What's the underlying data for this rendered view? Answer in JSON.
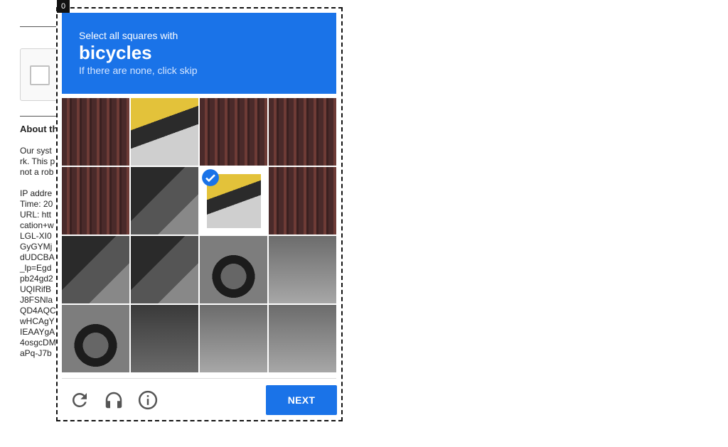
{
  "background": {
    "about_title": "About th",
    "paragraph": [
      "Our syst",
      "rk. This p",
      "not a rob"
    ],
    "details": [
      "IP addre",
      "Time: 20",
      "URL: htt",
      "cation+w",
      "LGL-XI0",
      "GyGYMj",
      "dUDCBA",
      "_lp=Egd",
      "pb24gd2",
      "UQIRifB",
      "J8FSNla",
      "QD4AQC",
      "wHCAgY",
      "IEAAYgA",
      "4osgcDM",
      "aPq-J7b"
    ]
  },
  "challenge": {
    "debug_index": "0",
    "instruction_prefix": "Select all squares with",
    "target": "bicycles",
    "hint": "If there are none, click skip",
    "tiles": [
      {
        "label": "tile 1",
        "selected": false
      },
      {
        "label": "tile 2",
        "selected": false
      },
      {
        "label": "tile 3",
        "selected": false
      },
      {
        "label": "tile 4",
        "selected": false
      },
      {
        "label": "tile 5",
        "selected": false
      },
      {
        "label": "tile 6",
        "selected": false
      },
      {
        "label": "tile 7",
        "selected": true
      },
      {
        "label": "tile 8",
        "selected": false
      },
      {
        "label": "tile 9",
        "selected": false
      },
      {
        "label": "tile 10",
        "selected": false
      },
      {
        "label": "tile 11",
        "selected": false
      },
      {
        "label": "tile 12",
        "selected": false
      },
      {
        "label": "tile 13",
        "selected": false
      },
      {
        "label": "tile 14",
        "selected": false
      },
      {
        "label": "tile 15",
        "selected": false
      },
      {
        "label": "tile 16",
        "selected": false
      }
    ],
    "next_label": "NEXT",
    "icons": {
      "reload": "reload-icon",
      "audio": "headphones-icon",
      "info": "info-icon"
    },
    "colors": {
      "accent": "#1a73e8",
      "check": "#1a73e8"
    }
  }
}
